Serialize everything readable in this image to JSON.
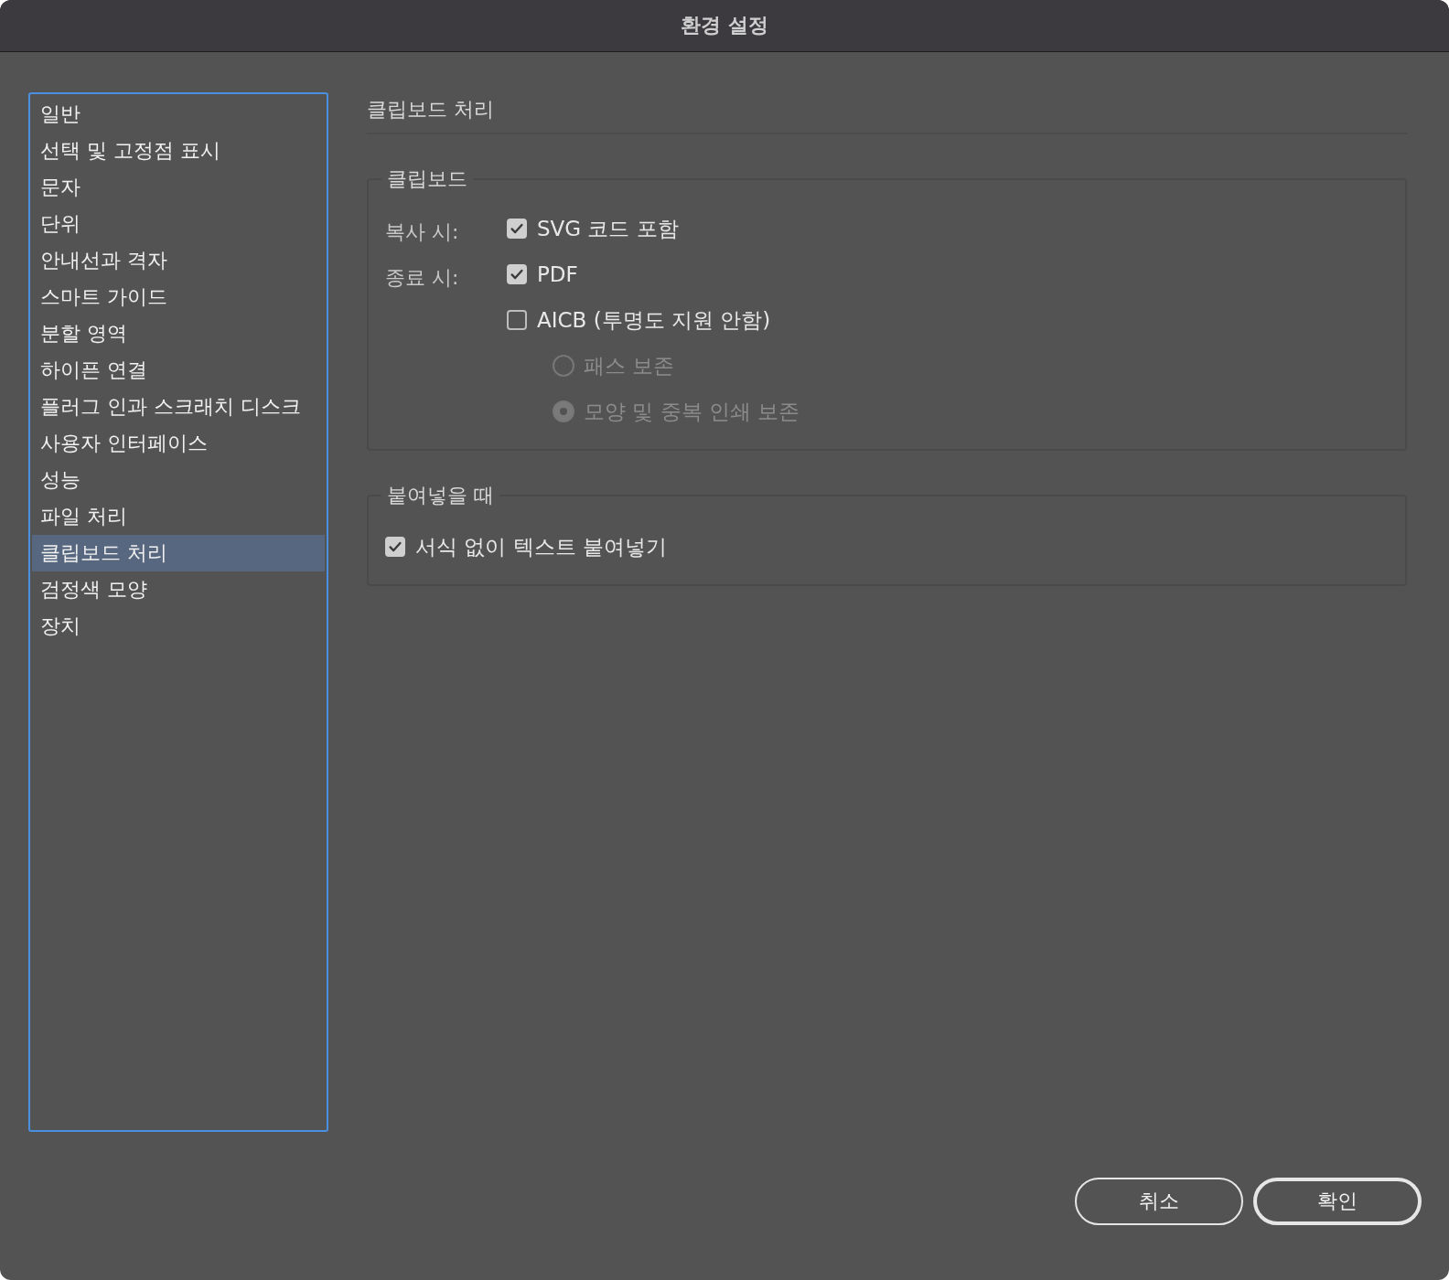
{
  "window": {
    "title": "환경 설정"
  },
  "sidebar": {
    "items": [
      {
        "label": "일반",
        "selected": false
      },
      {
        "label": "선택 및 고정점 표시",
        "selected": false
      },
      {
        "label": "문자",
        "selected": false
      },
      {
        "label": "단위",
        "selected": false
      },
      {
        "label": "안내선과 격자",
        "selected": false
      },
      {
        "label": "스마트 가이드",
        "selected": false
      },
      {
        "label": "분할 영역",
        "selected": false
      },
      {
        "label": "하이픈 연결",
        "selected": false
      },
      {
        "label": "플러그 인과 스크래치 디스크",
        "selected": false
      },
      {
        "label": "사용자 인터페이스",
        "selected": false
      },
      {
        "label": "성능",
        "selected": false
      },
      {
        "label": "파일 처리",
        "selected": false
      },
      {
        "label": "클립보드 처리",
        "selected": true
      },
      {
        "label": "검정색 모양",
        "selected": false
      },
      {
        "label": "장치",
        "selected": false
      }
    ]
  },
  "section": {
    "title": "클립보드 처리"
  },
  "clipboard_group": {
    "title": "클립보드",
    "options": [
      {
        "kind": "checkbox",
        "prefix": "복사 시:",
        "label": "SVG 코드 포함",
        "checked": true,
        "disabled": false
      },
      {
        "kind": "checkbox",
        "prefix": "종료 시:",
        "label": "PDF",
        "checked": true,
        "disabled": false
      },
      {
        "kind": "checkbox",
        "label": "AICB (투명도 지원 안함)",
        "checked": false,
        "disabled": false
      },
      {
        "kind": "radio",
        "label": "패스 보존",
        "selected": false,
        "disabled": true
      },
      {
        "kind": "radio",
        "label": "모양 및 중복 인쇄 보존",
        "selected": true,
        "disabled": true
      }
    ]
  },
  "paste_group": {
    "title": "붙여넣을 때",
    "options": [
      {
        "kind": "checkbox",
        "label": "서식 없이 텍스트 붙여넣기",
        "checked": true,
        "disabled": false
      }
    ]
  },
  "buttons": [
    {
      "label": "취소",
      "primary": false
    },
    {
      "label": "확인",
      "primary": true
    }
  ]
}
